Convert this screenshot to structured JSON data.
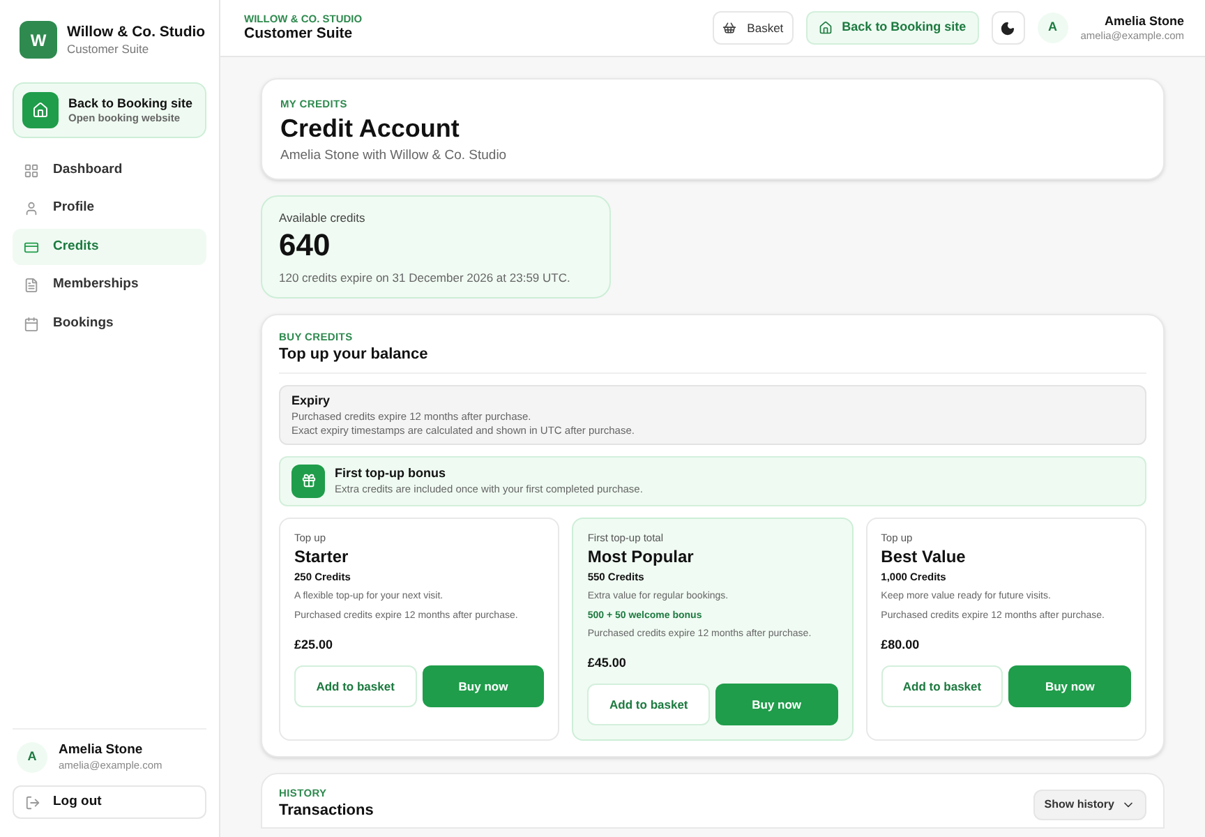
{
  "brand": {
    "initial": "W",
    "name": "Willow & Co. Studio",
    "subtitle": "Customer Suite"
  },
  "sidebar": {
    "back_link": {
      "title": "Back to Booking site",
      "subtitle": "Open booking website"
    },
    "items": [
      {
        "label": "Dashboard",
        "selected": false
      },
      {
        "label": "Profile",
        "selected": false
      },
      {
        "label": "Credits",
        "selected": true
      },
      {
        "label": "Memberships",
        "selected": false
      },
      {
        "label": "Bookings",
        "selected": false
      }
    ],
    "user": {
      "initial": "A",
      "name": "Amelia Stone",
      "email": "amelia@example.com"
    },
    "logout": "Log out"
  },
  "header": {
    "eyebrow": "WILLOW & CO. STUDIO",
    "title": "Customer Suite",
    "basket": "Basket",
    "back_link": "Back to Booking site",
    "user": {
      "initial": "A",
      "name": "Amelia Stone",
      "email": "amelia@example.com"
    }
  },
  "account": {
    "eyebrow": "MY CREDITS",
    "title": "Credit Account",
    "subtitle": "Amelia Stone with Willow & Co. Studio"
  },
  "balance": {
    "label": "Available credits",
    "value": "640",
    "note": "120 credits expire on 31 December 2026 at 23:59 UTC."
  },
  "buy": {
    "eyebrow": "BUY CREDITS",
    "title": "Top up your balance",
    "expiry": {
      "title": "Expiry",
      "lines": [
        "Purchased credits expire 12 months after purchase.",
        "Exact expiry timestamps are calculated and shown in UTC after purchase."
      ]
    },
    "bonus": {
      "title": "First top-up bonus",
      "text": "Extra credits are included once with your first completed purchase."
    },
    "plans": [
      {
        "tag": "Top up",
        "name": "Starter",
        "credits": "250 Credits",
        "description": "A flexible top-up for your next visit.",
        "expiry": "Purchased credits expire 12 months after purchase.",
        "price": "£25.00",
        "highlighted": false,
        "add": "Add to basket",
        "buy": "Buy now"
      },
      {
        "tag": "First top-up total",
        "name": "Most Popular",
        "credits": "550 Credits",
        "description": "Extra value for regular bookings.",
        "bonus": "500 + 50 welcome bonus",
        "expiry": "Purchased credits expire 12 months after purchase.",
        "price": "£45.00",
        "highlighted": true,
        "add": "Add to basket",
        "buy": "Buy now"
      },
      {
        "tag": "Top up",
        "name": "Best Value",
        "credits": "1,000 Credits",
        "description": "Keep more value ready for future visits.",
        "expiry": "Purchased credits expire 12 months after purchase.",
        "price": "£80.00",
        "highlighted": false,
        "add": "Add to basket",
        "buy": "Buy now"
      }
    ]
  },
  "history": {
    "eyebrow": "HISTORY",
    "title": "Transactions",
    "toggle": "Show history"
  }
}
